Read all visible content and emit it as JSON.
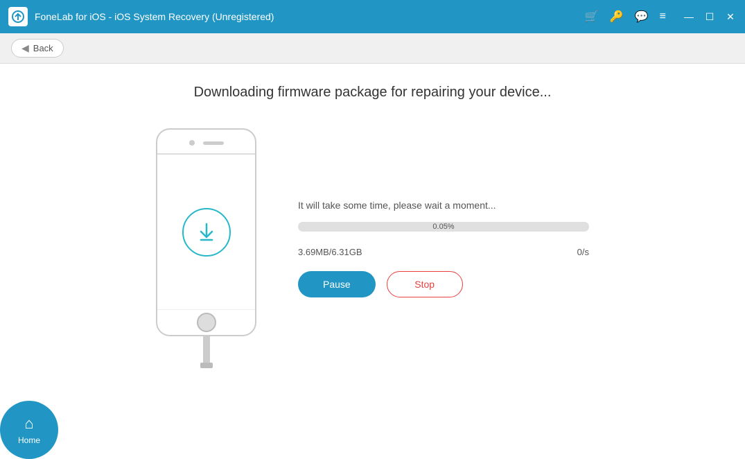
{
  "titleBar": {
    "title": "FoneLab for iOS - iOS System Recovery (Unregistered)",
    "icons": {
      "cart": "🛒",
      "key": "🔑",
      "chat": "💬",
      "menu": "≡"
    },
    "windowControls": {
      "minimize": "—",
      "maximize": "☐",
      "close": "✕"
    }
  },
  "navBar": {
    "backLabel": "Back"
  },
  "main": {
    "pageTitle": "Downloading firmware package for repairing your device...",
    "waitMessage": "It will take some time, please wait a moment...",
    "progress": {
      "percent": 0.05,
      "percentLabel": "0.05%",
      "downloaded": "3.69MB/6.31GB",
      "speed": "0/s"
    },
    "buttons": {
      "pause": "Pause",
      "stop": "Stop"
    }
  },
  "bottomBar": {
    "homeLabel": "Home"
  }
}
